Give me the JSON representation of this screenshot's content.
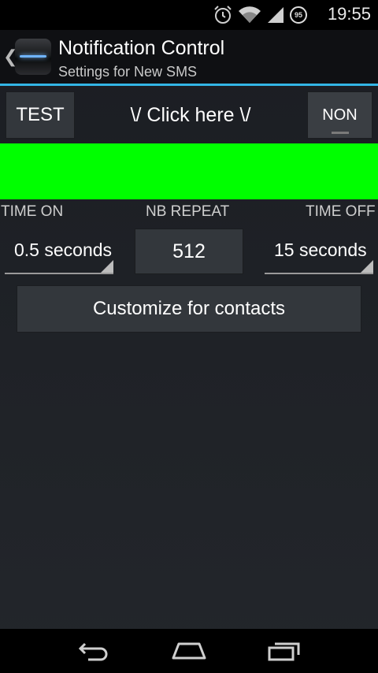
{
  "status_bar": {
    "time": "19:55",
    "battery_level": "95",
    "icons": [
      "alarm-icon",
      "wifi-icon",
      "signal-icon",
      "battery-icon"
    ]
  },
  "action_bar": {
    "title": "Notification Control",
    "subtitle": "Settings for New SMS",
    "accent_color": "#33b5e5"
  },
  "controls": {
    "test_label": "TEST",
    "click_here_label": "\\/ Click here \\/",
    "toggle_label": "NON"
  },
  "preview": {
    "color": "#00ff00"
  },
  "settings": {
    "time_on_label": "TIME ON",
    "nb_repeat_label": "NB REPEAT",
    "time_off_label": "TIME OFF",
    "time_on_value": "0.5 seconds",
    "nb_repeat_value": "512",
    "time_off_value": "15 seconds"
  },
  "customize_label": "Customize for contacts",
  "nav_bar": {
    "icons": [
      "back-icon",
      "home-icon",
      "recents-icon"
    ]
  }
}
